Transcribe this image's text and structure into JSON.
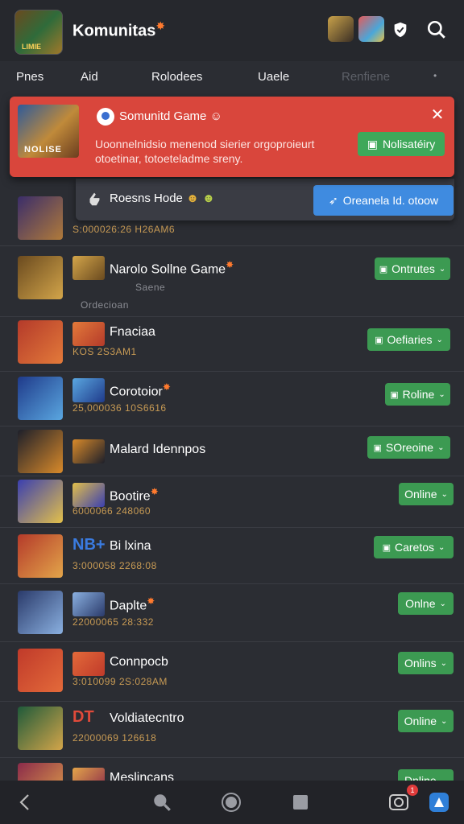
{
  "app": {
    "title": "Komunitas"
  },
  "tabs": [
    "Pnes",
    "Aid",
    "Rolodees",
    "Uaele",
    "Renfiene",
    "•"
  ],
  "notification": {
    "thumb_label": "NOLISE",
    "title": "Somunitd Game",
    "body": "Uoonnelnidsio menenod sierier orgoproieurt otoetinar, totoeteladme sreny.",
    "button_label": "Nolisatéiry"
  },
  "notification2": {
    "title": "Roesns Hode",
    "button_label": "Oreanela Id. otoow"
  },
  "rows": [
    {
      "title": "",
      "subtitle": "S:000026:26 H26AM6",
      "status": "",
      "thumb_colors": [
        "#3a2d6a",
        "#b07a3a"
      ]
    },
    {
      "title": "Narolo Sollne Game",
      "subtitle": "Saene",
      "subtitle2": "Ordecioan",
      "status": "Ontrutes",
      "thumb_colors": [
        "#6a4a1f",
        "#d3a54a"
      ]
    },
    {
      "title": "Fnaciaa",
      "subtitle": "KOS 2S3AM1",
      "status": "Oefiaries",
      "thumb_colors": [
        "#b43a2a",
        "#e37a3a"
      ]
    },
    {
      "title": "Corotoior",
      "subtitle": "25,000036 10S6616",
      "status": "Roline",
      "thumb_colors": [
        "#1f3a8a",
        "#5aa7e0"
      ]
    },
    {
      "title": "Malard Idennpos",
      "subtitle": "",
      "status": "SOreoine",
      "thumb_colors": [
        "#1d1f2a",
        "#d98a2a"
      ]
    },
    {
      "title": "Bootire",
      "subtitle": "6000066 248060",
      "status": "Online",
      "thumb_colors": [
        "#3a3fb0",
        "#e3c04a"
      ]
    },
    {
      "title": "Bi lxina",
      "prefix": "NB+",
      "subtitle": "3:000058 2268:08",
      "status": "Caretos",
      "thumb_colors": [
        "#b43a2a",
        "#e3a54a"
      ]
    },
    {
      "title": "Daplte",
      "subtitle": "22000065 28:332",
      "status": "Onlne",
      "thumb_colors": [
        "#2a3a6a",
        "#8ab0e0"
      ]
    },
    {
      "title": "Connpocb",
      "subtitle": "3:010099 2S:028AM",
      "status": "Onlins",
      "thumb_colors": [
        "#c03a2a",
        "#e36a3a"
      ]
    },
    {
      "title": "Voldiatecntro",
      "prefix": "DT",
      "subtitle": "22000069 126618",
      "status": "Online",
      "thumb_colors": [
        "#1f5a3a",
        "#d3a54a"
      ]
    },
    {
      "title": "Meslincans",
      "subtitle": "",
      "status": "Dnline",
      "thumb_colors": [
        "#8a2a4a",
        "#e3a54a"
      ]
    }
  ],
  "bottom_nav": {
    "notif_count": "1"
  },
  "colors": {
    "accent_green": "#3c9a52",
    "alert_red": "#d9463c",
    "button_blue": "#3f8be0",
    "timestamp": "#c79a54"
  }
}
